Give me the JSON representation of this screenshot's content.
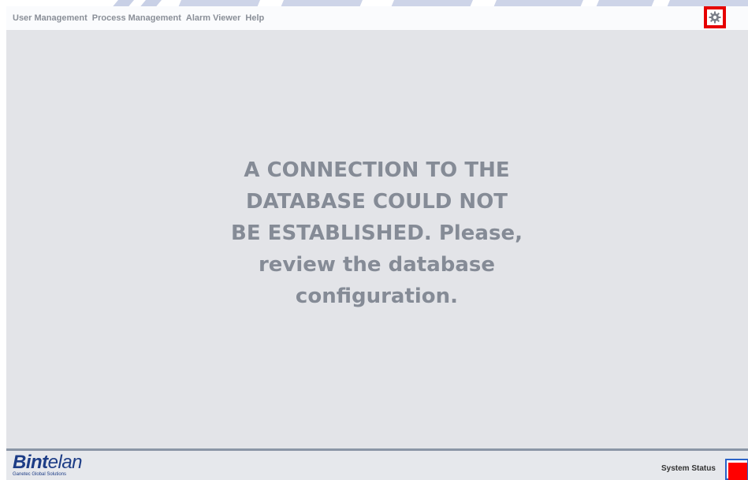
{
  "menu": {
    "items": [
      {
        "label": "User Management"
      },
      {
        "label": "Process Management"
      },
      {
        "label": "Alarm Viewer"
      },
      {
        "label": "Help"
      }
    ]
  },
  "settings": {
    "icon": "gear-icon",
    "highlight_color": "#e60000"
  },
  "main": {
    "message_lines": [
      "A CONNECTION TO THE",
      "DATABASE COULD NOT",
      "BE ESTABLISHED. Please,",
      "review the database",
      "configuration."
    ]
  },
  "footer": {
    "logo_text": "Bintelan",
    "logo_bold": "Bint",
    "logo_rest": "elan",
    "logo_tagline": "Ganetec Global Solutions",
    "status_label": "System Status",
    "status_color": "#ff0000"
  }
}
